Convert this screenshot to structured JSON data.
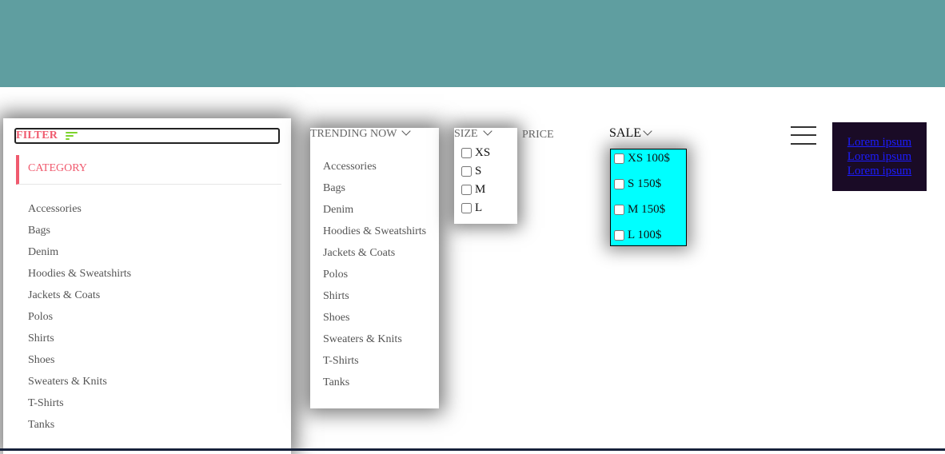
{
  "filter": {
    "label": "FILTER",
    "icon": "filter-icon",
    "accent_color": "#f05a6e",
    "icon_color": "#7dd32c",
    "category_label": "CATEGORY",
    "categories": [
      "Accessories",
      "Bags",
      "Denim",
      "Hoodies & Sweatshirts",
      "Jackets & Coats",
      "Polos",
      "Shirts",
      "Shoes",
      "Sweaters & Knits",
      "T-Shirts",
      "Tanks"
    ]
  },
  "trending": {
    "label": "TRENDING NOW",
    "icon": "chevron-down-icon",
    "items": [
      "Accessories",
      "Bags",
      "Denim",
      "Hoodies & Sweatshirts",
      "Jackets & Coats",
      "Polos",
      "Shirts",
      "Shoes",
      "Sweaters & Knits",
      "T-Shirts",
      "Tanks"
    ]
  },
  "size": {
    "label": "SIZE",
    "icon": "chevron-down-icon",
    "options": [
      "XS",
      "S",
      "M",
      "L"
    ]
  },
  "price": {
    "label": "PRICE"
  },
  "sale": {
    "label": "SALE",
    "icon": "chevron-down-icon",
    "background": "#00ffff",
    "options": [
      "XS 100$",
      "S 150$",
      "M 150$",
      "L 100$"
    ]
  },
  "menu": {
    "icon": "hamburger-menu-icon"
  },
  "lorem": {
    "links": [
      "Lorem ipsum",
      "Lorem ipsum",
      "Lorem ipsum"
    ],
    "background": "#1a0b26",
    "link_color": "#1c1cff"
  },
  "colors": {
    "banner": "#5f9ea0"
  }
}
